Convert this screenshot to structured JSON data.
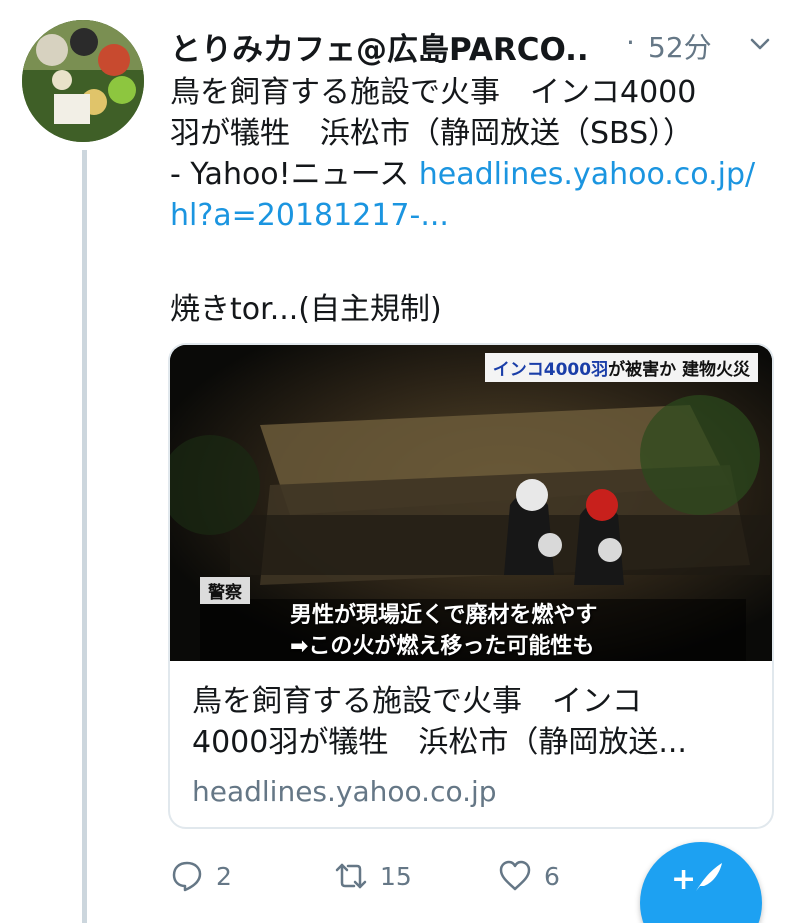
{
  "tweet": {
    "author": "とりみカフェ@広島PARCO...",
    "separator": "·",
    "time": "52分",
    "text_lines": [
      "鳥を飼育する施設で火事　インコ4000",
      "羽が犠牲　浜松市（静岡放送（SBS））"
    ],
    "text_line3_prefix": "- Yahoo!ニュース ",
    "link_part1": "headlines.yahoo.co.jp/",
    "link_part2": "hl?a=20181217-...",
    "text_extra": "焼きtor...(自主規制)"
  },
  "card": {
    "image_label_highlight": "インコ4000羽",
    "image_label_rest": "が被害か  建物火災",
    "police_tag": "警察",
    "caption_line1": "男性が現場近くで廃材を燃やす",
    "caption_line2": "➡この火が燃え移った可能性も",
    "title_line1": "鳥を飼育する施設で火事　インコ",
    "title_line2": "4000羽が犠牲　浜松市（静岡放送...",
    "domain": "headlines.yahoo.co.jp"
  },
  "actions": {
    "reply_count": "2",
    "retweet_count": "15",
    "like_count": "6"
  },
  "fab": {
    "plus": "+"
  },
  "colors": {
    "link": "#1b95e0",
    "muted": "#657786",
    "accent": "#1da1f2",
    "thread_line": "#ccd6dd"
  },
  "icons": [
    "avatar-image",
    "chevron-down-icon",
    "reply-icon",
    "retweet-icon",
    "like-icon",
    "compose-quill-icon"
  ]
}
